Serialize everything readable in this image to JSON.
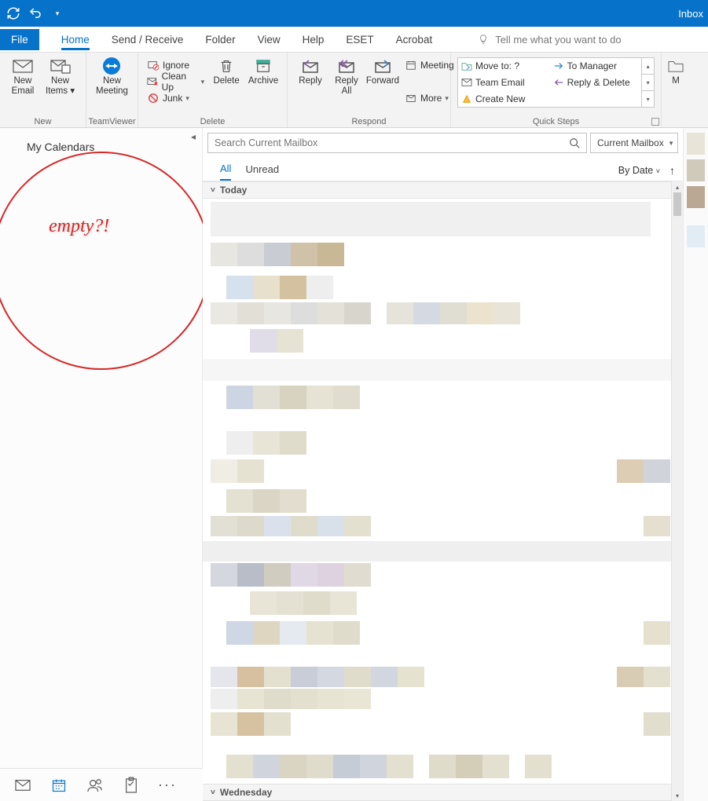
{
  "titlebar": {
    "right_text": "Inbox"
  },
  "tabs": {
    "file": "File",
    "home": "Home",
    "send_receive": "Send / Receive",
    "folder": "Folder",
    "view": "View",
    "help": "Help",
    "eset": "ESET",
    "acrobat": "Acrobat",
    "tellme": "Tell me what you want to do"
  },
  "ribbon": {
    "new": {
      "label": "New",
      "new_email_l1": "New",
      "new_email_l2": "Email",
      "new_items_l1": "New",
      "new_items_l2": "Items"
    },
    "teamviewer": {
      "label": "TeamViewer",
      "new_meeting_l1": "New",
      "new_meeting_l2": "Meeting"
    },
    "delete": {
      "label": "Delete",
      "ignore": "Ignore",
      "cleanup": "Clean Up",
      "junk": "Junk",
      "delete_btn": "Delete",
      "archive_btn": "Archive"
    },
    "respond": {
      "label": "Respond",
      "reply": "Reply",
      "reply_all_l1": "Reply",
      "reply_all_l2": "All",
      "forward": "Forward",
      "meeting": "Meeting",
      "more": "More"
    },
    "quicksteps": {
      "label": "Quick Steps",
      "move_to": "Move to: ?",
      "team_email": "Team Email",
      "create_new": "Create New",
      "to_manager": "To Manager",
      "reply_delete": "Reply & Delete"
    },
    "move_group": {
      "label": "M"
    }
  },
  "sidebar": {
    "title": "My Calendars",
    "annotation": "empty?!"
  },
  "search": {
    "placeholder": "Search Current Mailbox",
    "scope": "Current Mailbox"
  },
  "filters": {
    "all": "All",
    "unread": "Unread",
    "sort": "By Date"
  },
  "groups": {
    "today": "Today",
    "wednesday": "Wednesday"
  },
  "nav": {
    "more": "···"
  }
}
